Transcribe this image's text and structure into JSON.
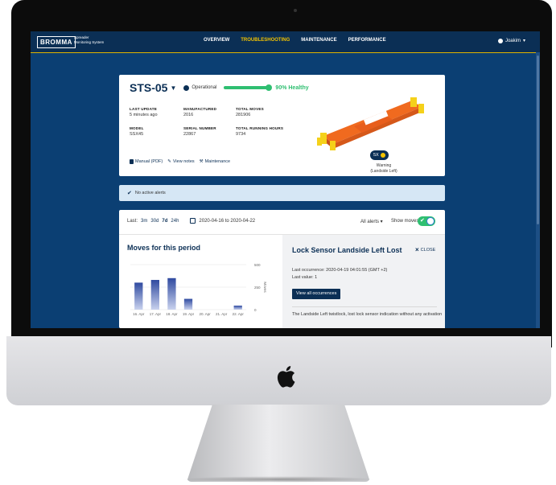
{
  "app": {
    "logo": "BROMMA",
    "subtitle_line1": "Spreader",
    "subtitle_line2": "Monitoring System"
  },
  "nav": {
    "items": [
      {
        "label": "OVERVIEW"
      },
      {
        "label": "TROUBLESHOOTING",
        "active": true
      },
      {
        "label": "MAINTENANCE"
      },
      {
        "label": "PERFORMANCE"
      }
    ]
  },
  "user": {
    "name": "Joakim"
  },
  "unit": {
    "name": "STS-05",
    "status": "Operational",
    "health_text": "90% Healthy",
    "health_fraction": 0.9
  },
  "fields": {
    "last_update_label": "LAST UPDATE",
    "last_update_value": "5 minutes ago",
    "manufactured_label": "MANUFACTURED",
    "manufactured_value": "2016",
    "total_moves_label": "TOTAL MOVES",
    "total_moves_value": "281906",
    "model_label": "MODEL",
    "model_value": "SSX45",
    "serial_label": "SERIAL NUMBER",
    "serial_value": "22867",
    "hours_label": "TOTAL RUNNING HOURS",
    "hours_value": "9734"
  },
  "links": {
    "manual": "Manual (PDF)",
    "notes": "View notes",
    "maintenance": "Maintenance"
  },
  "device_badge": {
    "count": "5X",
    "warning_line1": "Warning",
    "warning_line2": "(Landside Left)"
  },
  "alert_bar": {
    "text": "No active alerts"
  },
  "period": {
    "label": "Last:",
    "options": [
      "3m",
      "30d",
      "7d",
      "24h"
    ],
    "selected": "7d",
    "date_range": "2020-04-16 to 2020-04-22",
    "alerts_dropdown": "All alerts",
    "show_moves_label": "Show moves",
    "show_moves_on": true
  },
  "moves": {
    "title": "Moves for this period"
  },
  "chart_data": {
    "type": "bar",
    "categories": [
      "16. Apr",
      "17. Apr",
      "18. Apr",
      "19. Apr",
      "20. Apr",
      "21. Apr",
      "22. Apr"
    ],
    "values": [
      300,
      330,
      350,
      120,
      0,
      0,
      45
    ],
    "ylim": [
      0,
      500
    ],
    "yticks": [
      "0",
      "250",
      "500"
    ],
    "ylabel": "Moves",
    "grid": true,
    "colors": {
      "bar_top": "#2f4aa0",
      "bar_bottom": "#c9d2ee"
    }
  },
  "alert_panel": {
    "title": "Lock Sensor Landside Left Lost",
    "close_label": "CLOSE",
    "last_occurrence": "Last occurrence: 2020-04-19 04:01:55 (GMT +2)",
    "last_value": "Last value: 1",
    "button": "View all occurrences",
    "description": "The Landside Left twistlock, lost lock sensor indication without any activation"
  },
  "colors": {
    "screen_bg": "#0b3f73",
    "topbar": "#0b2f55",
    "accent_yellow": "#f3c300",
    "healthy_green": "#2fbf71"
  }
}
